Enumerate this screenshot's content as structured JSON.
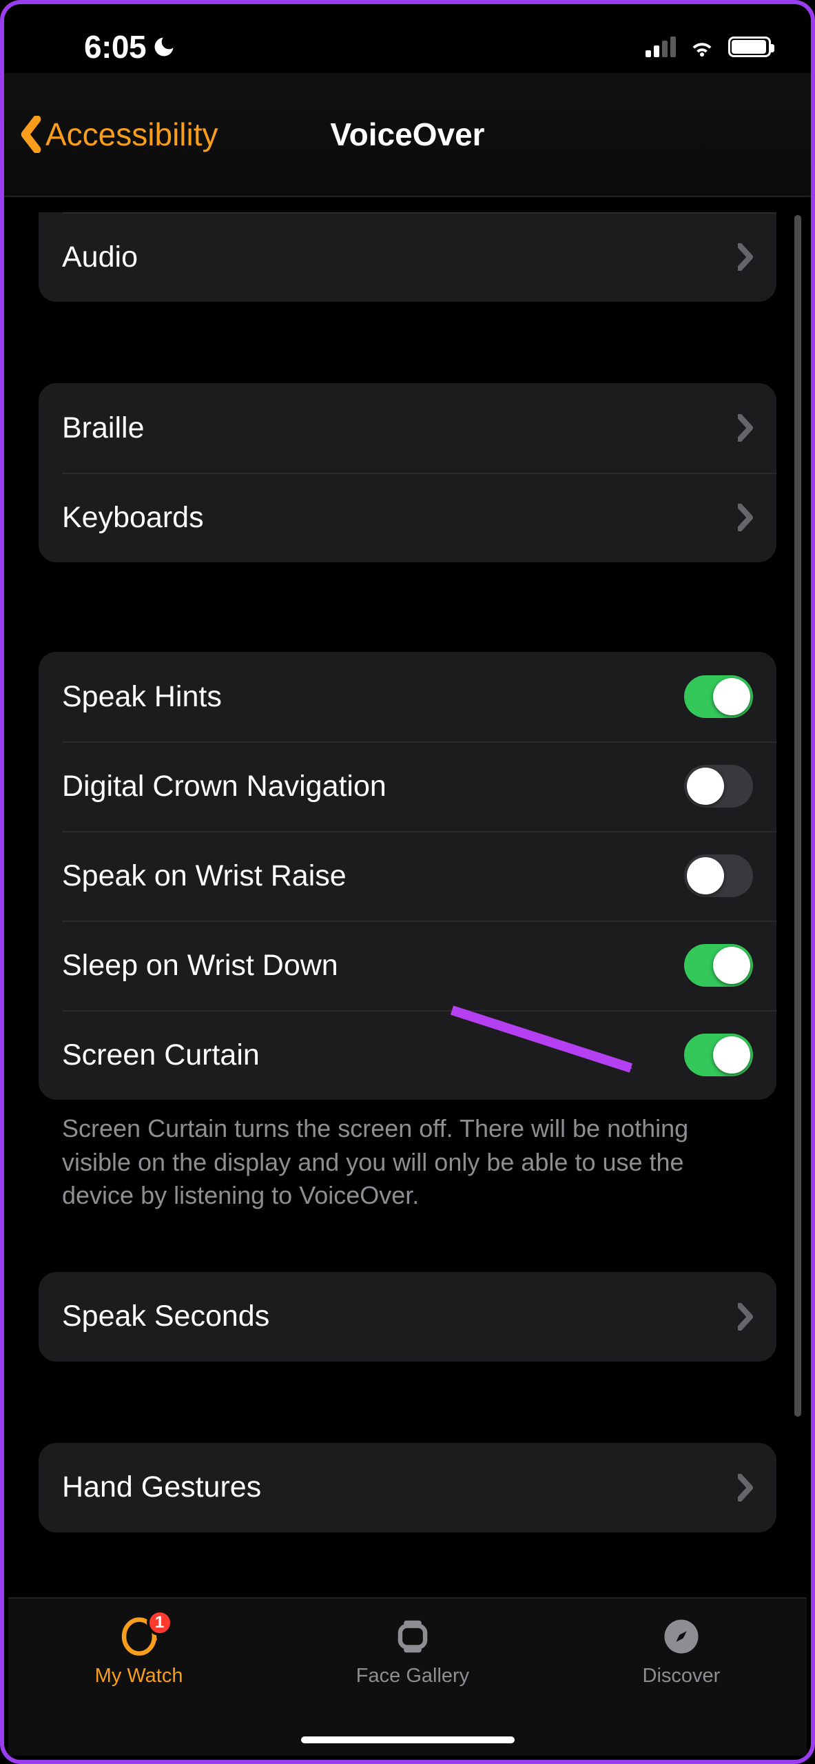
{
  "status": {
    "time": "6:05"
  },
  "nav": {
    "back_label": "Accessibility",
    "title": "VoiceOver"
  },
  "group0": {
    "audio": "Audio"
  },
  "group1": {
    "braille": "Braille",
    "keyboards": "Keyboards"
  },
  "group2": {
    "speak_hints": {
      "label": "Speak Hints",
      "on": true
    },
    "digital_crown_navigation": {
      "label": "Digital Crown Navigation",
      "on": false
    },
    "speak_on_wrist_raise": {
      "label": "Speak on Wrist Raise",
      "on": false
    },
    "sleep_on_wrist_down": {
      "label": "Sleep on Wrist Down",
      "on": true
    },
    "screen_curtain": {
      "label": "Screen Curtain",
      "on": true
    }
  },
  "footer_screen_curtain": "Screen Curtain turns the screen off. There will be nothing visible on the display and you will only be able to use the device by listening to VoiceOver.",
  "group3": {
    "speak_seconds": "Speak Seconds"
  },
  "group4": {
    "hand_gestures": "Hand Gestures"
  },
  "tabs": {
    "my_watch": {
      "label": "My Watch",
      "badge": "1"
    },
    "face_gallery": {
      "label": "Face Gallery"
    },
    "discover": {
      "label": "Discover"
    }
  },
  "colors": {
    "accent": "#f89d1c",
    "toggle_on": "#34c759",
    "annotation": "#b540f2"
  }
}
